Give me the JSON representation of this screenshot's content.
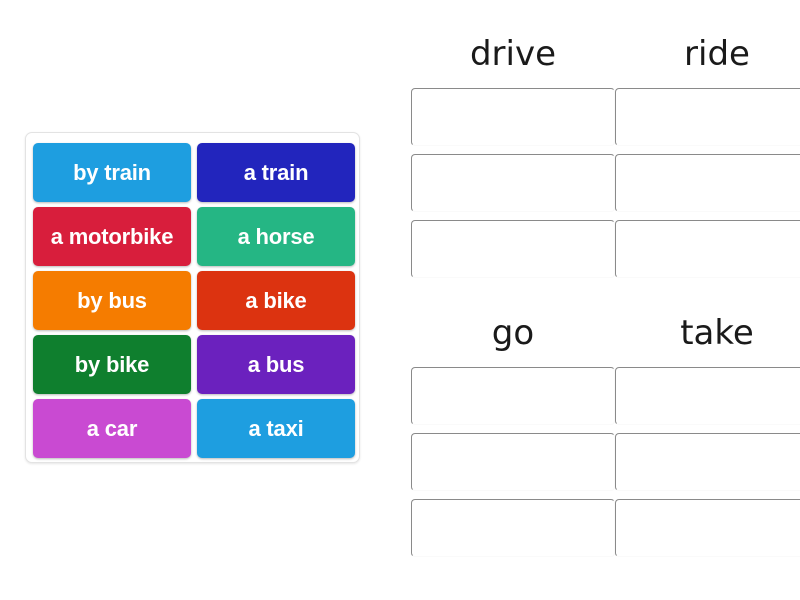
{
  "activity": {
    "type": "group-sort",
    "background_color": "#ffffff"
  },
  "tray": {
    "name": "word-tile-tray",
    "border_color": "#e3e3e3",
    "tiles": [
      {
        "label": "by train",
        "color": "#1e9ee0"
      },
      {
        "label": "a train",
        "color": "#2225bd"
      },
      {
        "label": "a motorbike",
        "color": "#d81e3c"
      },
      {
        "label": "a horse",
        "color": "#25b684"
      },
      {
        "label": "by bus",
        "color": "#f57c00"
      },
      {
        "label": "a bike",
        "color": "#dc3310"
      },
      {
        "label": "by bike",
        "color": "#0f7f2e"
      },
      {
        "label": "a bus",
        "color": "#6b21be"
      },
      {
        "label": "a car",
        "color": "#c94ad2"
      },
      {
        "label": "a taxi",
        "color": "#1e9ee0"
      }
    ]
  },
  "zones": [
    {
      "title": "drive",
      "slots": [
        "",
        "",
        ""
      ]
    },
    {
      "title": "ride",
      "slots": [
        "",
        "",
        ""
      ]
    },
    {
      "title": "go",
      "slots": [
        "",
        "",
        ""
      ]
    },
    {
      "title": "take",
      "slots": [
        "",
        "",
        ""
      ]
    }
  ]
}
